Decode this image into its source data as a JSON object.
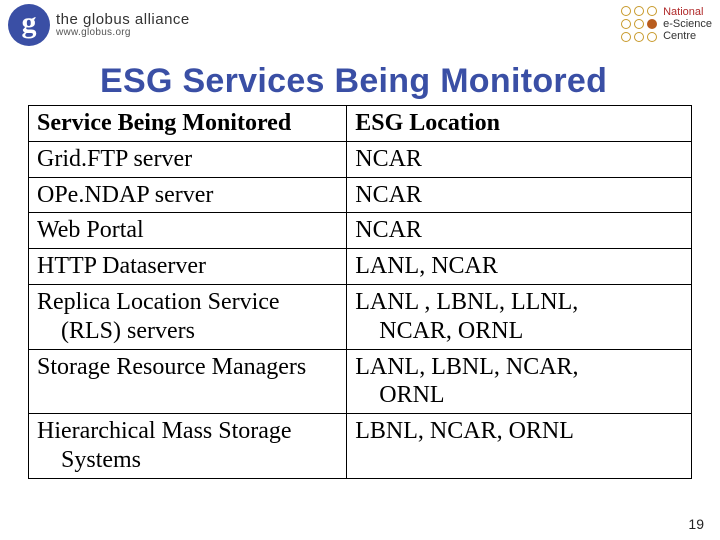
{
  "header": {
    "globus_line1": "the globus alliance",
    "globus_line2": "www.globus.org",
    "nesc_line1": "National",
    "nesc_line2": "e-Science",
    "nesc_line3": "Centre"
  },
  "title": "ESG Services Being Monitored",
  "table": {
    "head": {
      "col1": "Service Being Monitored",
      "col2": "ESG Location"
    },
    "rows": [
      {
        "c1a": "Grid.FTP server",
        "c1b": "",
        "c2a": "NCAR",
        "c2b": ""
      },
      {
        "c1a": "OPe.NDAP server",
        "c1b": "",
        "c2a": "NCAR",
        "c2b": ""
      },
      {
        "c1a": "Web Portal",
        "c1b": "",
        "c2a": "NCAR",
        "c2b": ""
      },
      {
        "c1a": "HTTP Dataserver",
        "c1b": "",
        "c2a": "LANL, NCAR",
        "c2b": ""
      },
      {
        "c1a": "Replica  Location  Service",
        "c1b": "(RLS) servers",
        "c2a": "LANL , LBNL, LLNL,",
        "c2b": "NCAR, ORNL"
      },
      {
        "c1a": "Storage Resource Managers",
        "c1b": "",
        "c2a": "LANL, LBNL,  NCAR,",
        "c2b": "ORNL"
      },
      {
        "c1a": "Hierarchical Mass Storage",
        "c1b": "Systems",
        "c2a": "LBNL, NCAR, ORNL",
        "c2b": ""
      }
    ]
  },
  "slide_number": "19"
}
